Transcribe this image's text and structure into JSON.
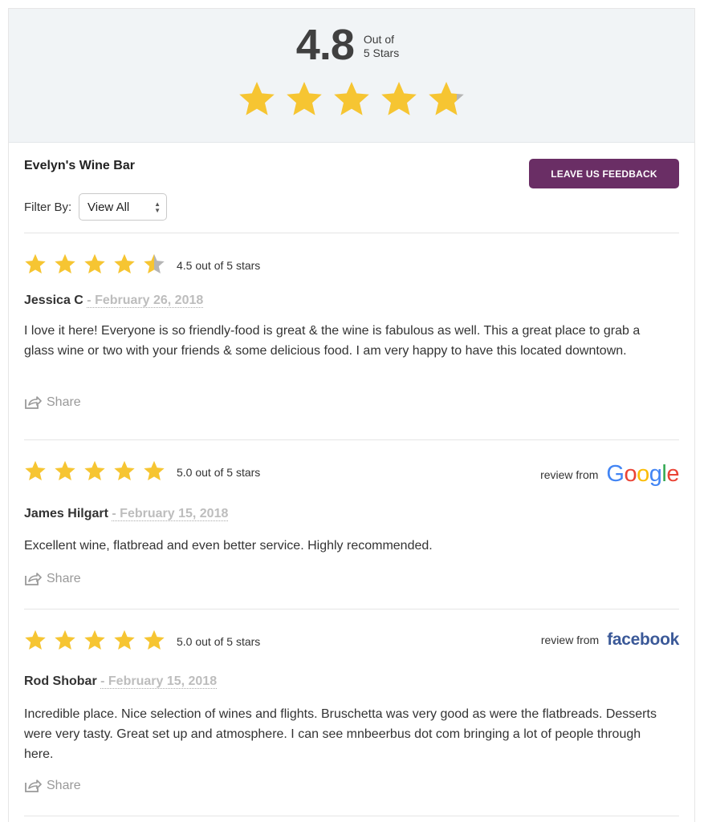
{
  "summary": {
    "score": "4.8",
    "out_of_line1": "Out of",
    "out_of_line2": "5 Stars",
    "rating": 4.8
  },
  "business": {
    "name": "Evelyn's Wine Bar",
    "feedback_button": "LEAVE US FEEDBACK",
    "filter_label": "Filter By:",
    "filter_value": "View All"
  },
  "reviews": [
    {
      "rating": 4.5,
      "rating_text": "4.5 out of 5 stars",
      "author": "Jessica C",
      "date": "- February 26, 2018",
      "body": "I love it here! Everyone is so friendly-food is great & the wine is fabulous as well. This a great place to grab a glass wine or two with your friends & some delicious food. I am very happy to have this located downtown.",
      "share": "Share"
    },
    {
      "rating": 5.0,
      "rating_text": "5.0 out of 5 stars",
      "author": "James Hilgart",
      "date": "- February 15, 2018",
      "body": "Excellent wine, flatbread and even better service. Highly recommended.",
      "share": "Share",
      "source_label": "review from",
      "source": "Google"
    },
    {
      "rating": 5.0,
      "rating_text": "5.0 out of 5 stars",
      "author": "Rod Shobar",
      "date": "- February 15, 2018",
      "body": "Incredible place. Nice selection of wines and flights. Bruschetta was very good as were the flatbreads. Desserts were very tasty. Great set up and atmosphere. I can see mnbeerbus dot com bringing a lot of people through here.",
      "share": "Share",
      "source_label": "review from",
      "source": "facebook"
    }
  ],
  "colors": {
    "star": "#f6c532",
    "star_empty": "#b5b5b5",
    "button": "#6a2e65",
    "facebook": "#3b5998"
  }
}
